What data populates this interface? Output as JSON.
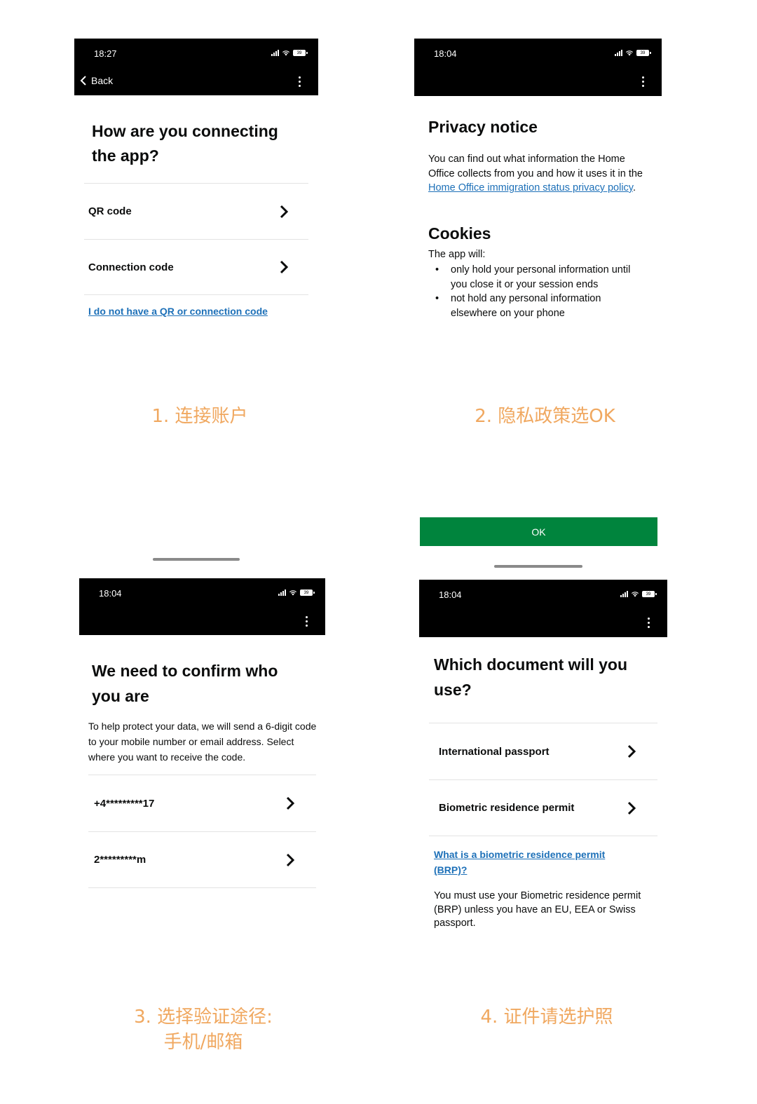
{
  "screen1": {
    "time": "18:27",
    "battery": "39",
    "back_label": "Back",
    "title": "How are you connecting the app?",
    "options": [
      "QR code",
      "Connection code"
    ],
    "no_code_link": "I do not have a QR or connection code",
    "caption": "1. 连接账户"
  },
  "screen2": {
    "time": "18:04",
    "battery": "39",
    "title": "Privacy notice",
    "intro": "You can find out what information the Home Office collects from you and how it uses it in the ",
    "policy_link": "Home Office immigration status privacy policy",
    "intro_end": ".",
    "cookies_title": "Cookies",
    "cookies_intro": "The app will:",
    "bullets": [
      "only hold your personal information until you close it or your session ends",
      "not hold any personal information elsewhere on your phone"
    ],
    "caption": "2. 隐私政策选OK",
    "ok_label": "OK"
  },
  "screen3": {
    "time": "18:04",
    "battery": "39",
    "title": "We need to confirm who you are",
    "description": "To help protect your data, we will send a 6-digit code to your mobile number or email address. Select where you want to receive the code.",
    "options": [
      "+4*********17",
      "2*********m"
    ],
    "caption_line1": "3. 选择验证途径:",
    "caption_line2": "手机/邮箱"
  },
  "screen4": {
    "time": "18:04",
    "battery": "39",
    "title": "Which document will you use?",
    "options": [
      "International passport",
      "Biometric residence permit"
    ],
    "brp_link": "What is a biometric residence permit (BRP)?",
    "note": "You must use your Biometric residence permit (BRP) unless you have an EU, EEA or Swiss passport.",
    "caption": "4. 证件请选护照"
  }
}
